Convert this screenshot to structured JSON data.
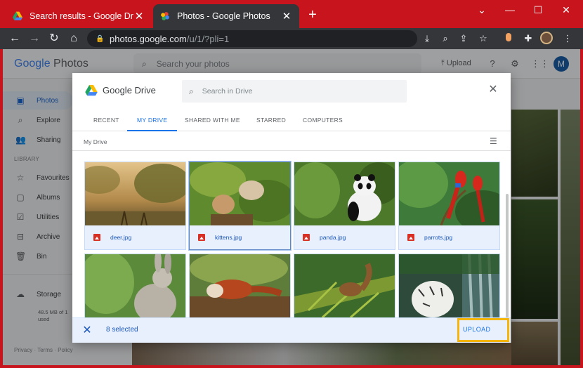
{
  "browser": {
    "tabs": [
      {
        "title": "Search results - Google Drive",
        "close": "✕",
        "active": false
      },
      {
        "title": "Photos - Google Photos",
        "close": "✕",
        "active": true
      }
    ],
    "new_tab": "+",
    "window_controls": [
      "⌄",
      "—",
      "☐",
      "✕"
    ],
    "url_host": "photos.google.com",
    "url_path": "/u/1/?pli=1"
  },
  "photos_app": {
    "logo_google": "Google",
    "logo_product": "Photos",
    "search_placeholder": "Search your photos",
    "upload_label": "Upload",
    "avatar_initial": "M",
    "sidebar": [
      {
        "label": "Photos",
        "icon": "photo-icon",
        "selected": true
      },
      {
        "label": "Explore",
        "icon": "search-icon",
        "selected": false
      },
      {
        "label": "Sharing",
        "icon": "people-icon",
        "selected": false
      }
    ],
    "library_heading": "LIBRARY",
    "library": [
      {
        "label": "Favourites",
        "icon": "star-icon"
      },
      {
        "label": "Albums",
        "icon": "album-icon"
      },
      {
        "label": "Utilities",
        "icon": "check-box-icon"
      },
      {
        "label": "Archive",
        "icon": "archive-icon"
      },
      {
        "label": "Bin",
        "icon": "trash-icon"
      }
    ],
    "storage_label": "Storage",
    "storage_note_1": "48.5 MB of 1",
    "storage_note_2": "used",
    "footer_privacy": "Privacy",
    "footer_sep": "·",
    "footer_terms": "Terms",
    "footer_policy": "Policy"
  },
  "picker": {
    "title": "Google Drive",
    "search_placeholder": "Search in Drive",
    "tabs": [
      "RECENT",
      "MY DRIVE",
      "SHARED WITH ME",
      "STARRED",
      "COMPUTERS"
    ],
    "active_tab": "MY DRIVE",
    "breadcrumb": "My Drive",
    "files": [
      {
        "name": "deer.jpg"
      },
      {
        "name": "kittens.jpg"
      },
      {
        "name": "panda.jpg"
      },
      {
        "name": "parrots.jpg"
      },
      {
        "name": ""
      },
      {
        "name": ""
      },
      {
        "name": ""
      },
      {
        "name": ""
      }
    ],
    "selected_text": "8 selected",
    "upload_label": "UPLOAD"
  },
  "colors": {
    "frame": "#c8141c",
    "accent": "#1a73e8",
    "highlight": "#f5b50a"
  }
}
